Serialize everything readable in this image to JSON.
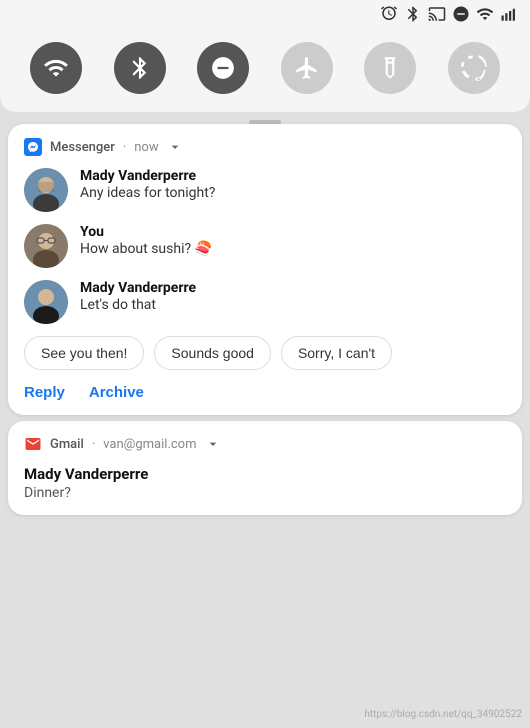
{
  "statusBar": {
    "icons": [
      "alarm",
      "bluetooth",
      "cast",
      "dnd",
      "wifi",
      "signal"
    ]
  },
  "quickSettings": {
    "icons": [
      {
        "name": "wifi",
        "active": true,
        "label": "Wi-Fi"
      },
      {
        "name": "bluetooth",
        "active": true,
        "label": "Bluetooth"
      },
      {
        "name": "dnd",
        "active": true,
        "label": "Do Not Disturb"
      },
      {
        "name": "airplane",
        "active": false,
        "label": "Airplane Mode"
      },
      {
        "name": "flashlight",
        "active": false,
        "label": "Flashlight"
      },
      {
        "name": "rotate",
        "active": false,
        "label": "Auto Rotate"
      }
    ]
  },
  "messengerNotification": {
    "appName": "Messenger",
    "time": "now",
    "messages": [
      {
        "sender": "Mady Vanderperre",
        "text": "Any ideas for tonight?",
        "isUser": false
      },
      {
        "sender": "You",
        "text": "How about sushi? 🍣",
        "isUser": true
      },
      {
        "sender": "Mady Vanderperre",
        "text": "Let's do that",
        "isUser": false
      }
    ],
    "quickReplies": [
      "See you then!",
      "Sounds good",
      "Sorry, I can't"
    ],
    "actions": [
      "Reply",
      "Archive"
    ]
  },
  "gmailNotification": {
    "appName": "Gmail",
    "account": "van@gmail.com",
    "sender": "Mady Vanderperre",
    "subject": "Dinner?"
  },
  "watermark": "https://blog.csdn.net/qq_34902522"
}
